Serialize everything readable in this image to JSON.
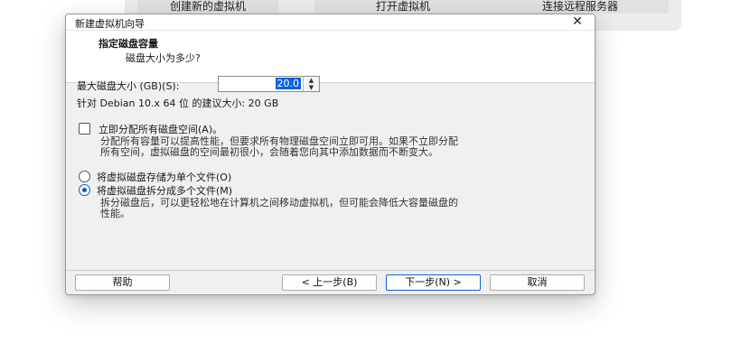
{
  "home": {
    "create_vm": "创建新的虚拟机",
    "open_vm": "打开虚拟机",
    "connect_server": "连接远程服务器"
  },
  "dialog": {
    "title": "新建虚拟机向导",
    "close_icon": "close-icon",
    "header_title": "指定磁盘容量",
    "header_sub": "磁盘大小为多少?",
    "max_size_label": "最大磁盘大小 (GB)(S):",
    "max_size_value": "20.0",
    "recommend_text": "针对 Debian 10.x 64 位 的建议大小: 20 GB",
    "allocate_label": "立即分配所有磁盘空间(A)。",
    "allocate_checked": false,
    "allocate_desc_1": "分配所有容量可以提高性能，但要求所有物理磁盘空间立即可用。如果不立即分配",
    "allocate_desc_2": "所有空间，虚拟磁盘的空间最初很小，会随着您向其中添加数据而不断变大。",
    "single_file_label": "将虚拟磁盘存储为单个文件(O)",
    "multi_file_label": "将虚拟磁盘拆分成多个文件(M)",
    "selected_option": "multi",
    "multi_desc_1": "拆分磁盘后，可以更轻松地在计算机之间移动虚拟机，但可能会降低大容量磁盘的",
    "multi_desc_2": "性能。",
    "buttons": {
      "help": "帮助",
      "back": "< 上一步(B)",
      "next": "下一步(N) >",
      "cancel": "取消"
    },
    "accent_color": "#0a64d6"
  }
}
